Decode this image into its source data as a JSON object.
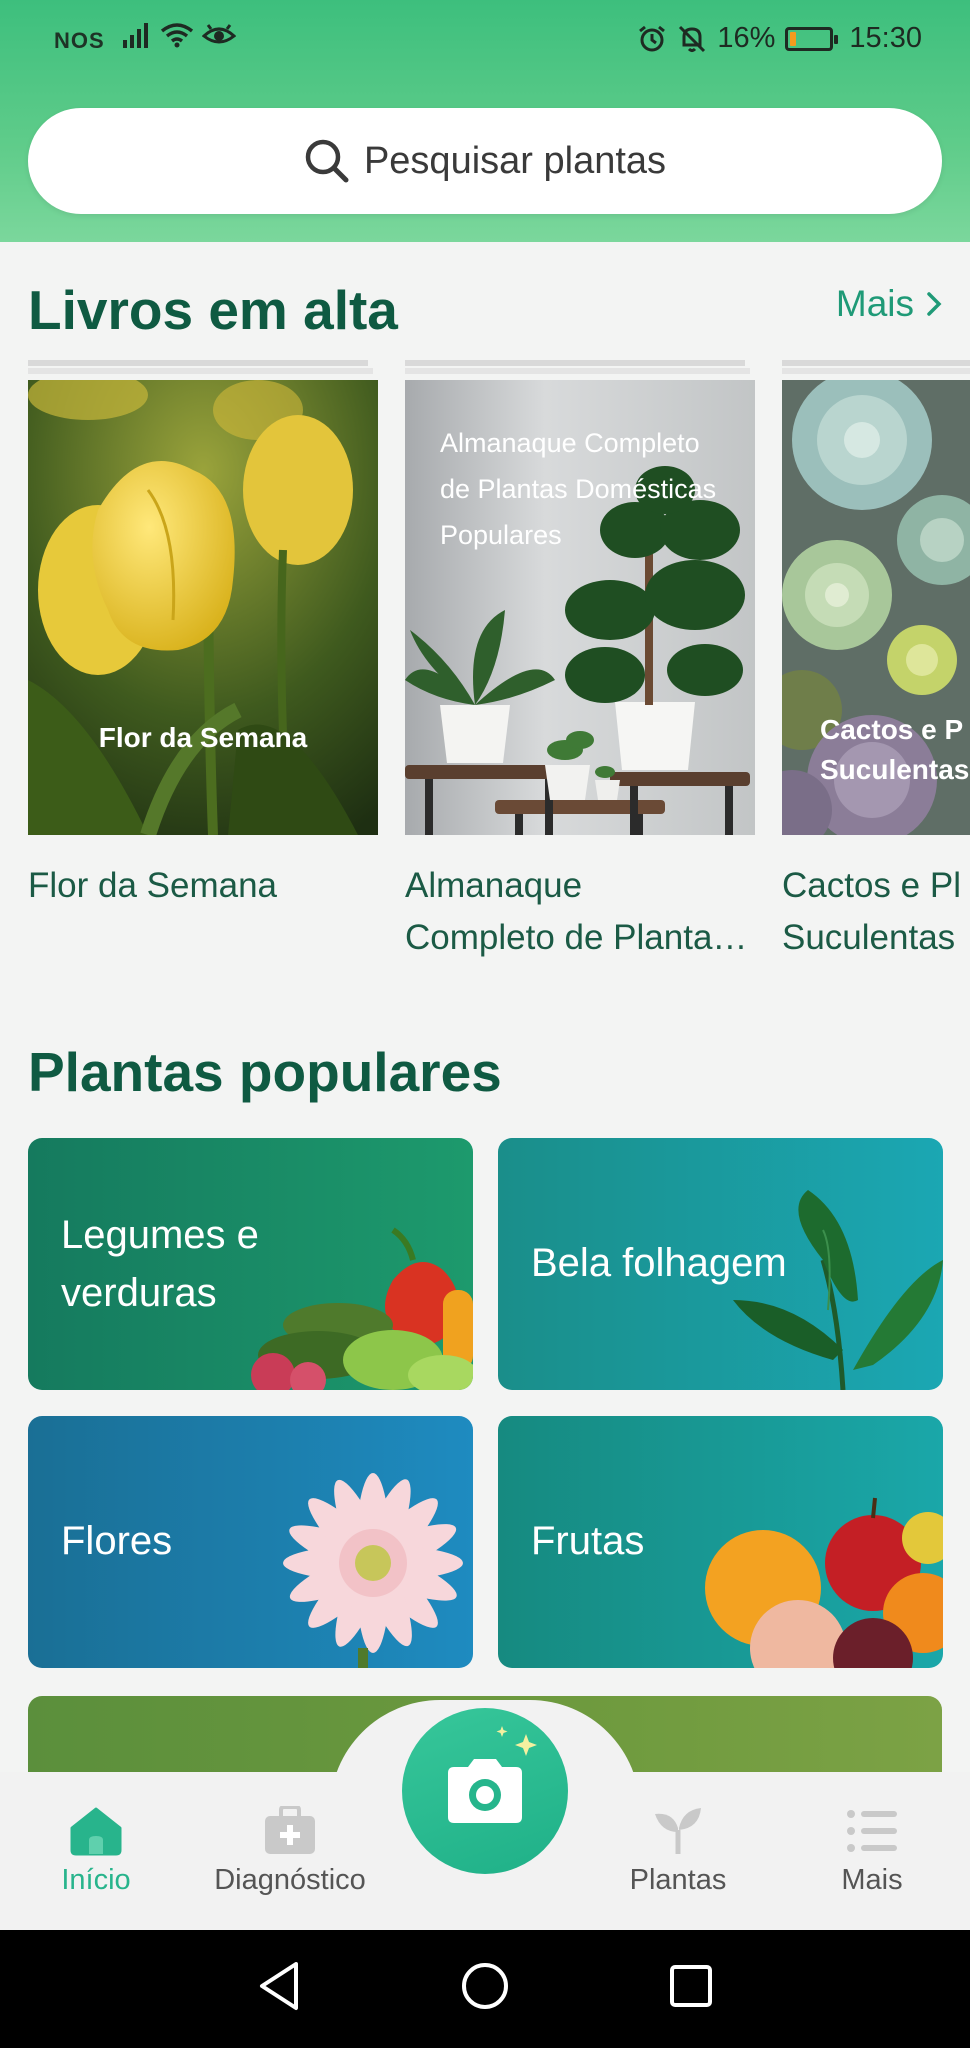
{
  "status_bar": {
    "carrier": "NOS",
    "battery_percent": "16%",
    "battery_level": 0.16,
    "time": "15:30"
  },
  "search": {
    "placeholder": "Pesquisar plantas"
  },
  "trending_books": {
    "title": "Livros em alta",
    "more_label": "Mais",
    "items": [
      {
        "cover_text": "Flor da Semana",
        "caption": "Flor da Semana"
      },
      {
        "cover_text": "Almanaque Completo de Plantas Domésticas Populares",
        "caption_line1": "Almanaque",
        "caption_line2": "Completo de Plantas Domésticas Populares"
      },
      {
        "cover_text_line1": "Cactos e P",
        "cover_text_line2": "Suculentas",
        "caption_line1": "Cactos e Pl",
        "caption_line2": "Suculentas"
      }
    ]
  },
  "popular_plants": {
    "title": "Plantas populares",
    "tiles": [
      {
        "label_line1": "Legumes e",
        "label_line2": "verduras"
      },
      {
        "label": "Bela folhagem"
      },
      {
        "label": "Flores"
      },
      {
        "label": "Frutas"
      }
    ]
  },
  "bottom_nav": {
    "items": [
      {
        "label": "Início",
        "icon": "home-icon",
        "active": true
      },
      {
        "label": "Diagnóstico",
        "icon": "medkit-icon"
      },
      {
        "label": "Plantas",
        "icon": "sprout-icon"
      },
      {
        "label": "Mais",
        "icon": "list-icon"
      }
    ],
    "camera_icon": "camera-icon"
  },
  "colors": {
    "accent": "#28b48c",
    "header_green": "#4cc583",
    "title_green": "#0f5a42"
  }
}
